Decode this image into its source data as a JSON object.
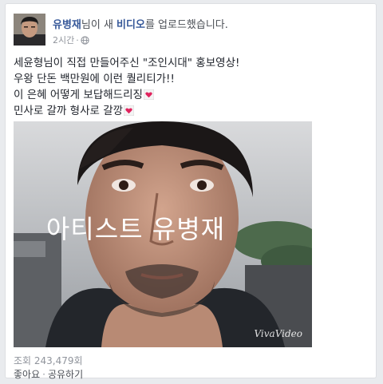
{
  "post": {
    "author": "유병재",
    "header_middle": "님이 새 ",
    "header_object": "비디오",
    "header_end": "를 업로드했습니다.",
    "time": "2시간",
    "privacy_icon": "globe-icon",
    "text_lines": [
      "세윤형님이 직접 만들어주신 \"조인시대\" 홍보영상!",
      "우왕 단돈 백만원에 이런 퀄리티가!!",
      "이 은혜 어떻게 보답해드리징",
      "민사로 갈까 형사로 갈깡"
    ],
    "emoji_icon": "heart-icon"
  },
  "video": {
    "overlay_title": "아티스트 유병재",
    "watermark": "VivaVideo"
  },
  "footer": {
    "views": "조회 243,479회",
    "like_label": "좋아요",
    "separator": "·",
    "share_label": "공유하기"
  },
  "colors": {
    "link_blue": "#365899",
    "meta_gray": "#90949c",
    "heart_red": "#e0245e"
  }
}
